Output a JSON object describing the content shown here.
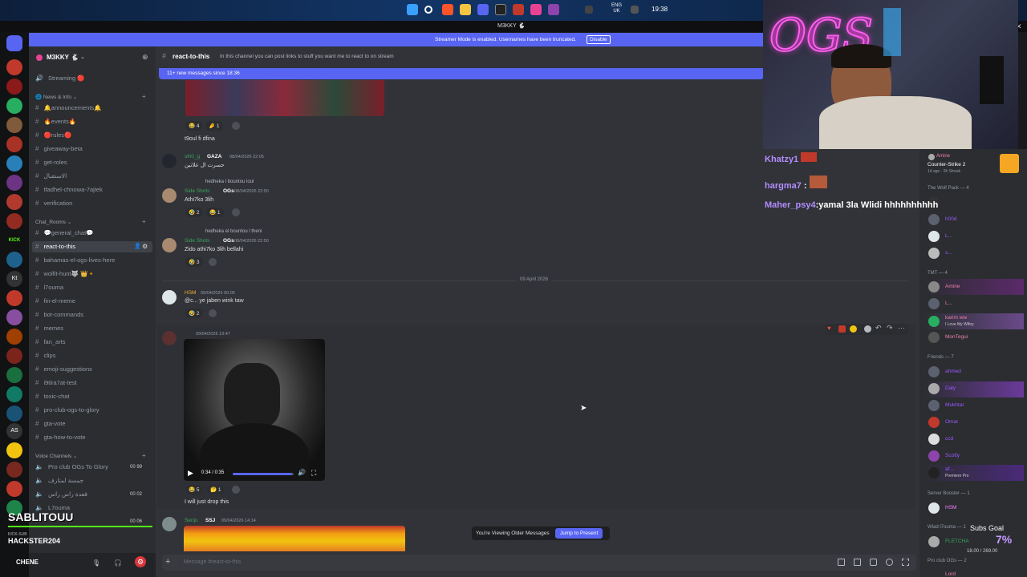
{
  "os": {
    "time": "19:38",
    "lang_top": "ENG",
    "lang_bottom": "UK"
  },
  "window": {
    "title": "M3KKY 🐇"
  },
  "banner": {
    "text": "Streamer Mode is enabled. Usernames have been truncated.",
    "button": "Disable"
  },
  "server": {
    "name": "M3KKY 🐇"
  },
  "sidebar": {
    "top_items": [
      {
        "label": "Streaming 🔴"
      }
    ],
    "category_news": "News & Info",
    "news": [
      "🔔announcements🔔",
      "🔥events🔥",
      "🔴rules🔴",
      "giveaway-beta",
      "get-roles",
      "الاستقبال",
      "tfadhel-chnowa-7ajtek",
      "verification"
    ],
    "category_chat": "Chat_Rooms",
    "chat": [
      "💬general_chat💬",
      "react-to-this",
      "bahamas-el-ogs-lives-here",
      "wolfit-hunt🐺 👑🔸",
      "l7ouma",
      "fin-el-meme",
      "bot-commands",
      "memes",
      "fan_arts",
      "clips",
      "emoji-suggestions",
      "i9tira7at-test",
      "toxic-chat",
      "pro-club-ogs-to-glory",
      "gta-vote",
      "gta-how-to-vote"
    ],
    "category_voice": "Voice Channels",
    "voice": [
      {
        "label": "Pro club OGs To Glory",
        "count": "00 99"
      },
      {
        "label": "جمسة لمتارف",
        "count": ""
      },
      {
        "label": "قعدة راس راس",
        "count": "00 02"
      },
      {
        "label": "L7ouma",
        "count": ""
      },
      {
        "label": "",
        "count": "00 06"
      }
    ],
    "user_name": "HACKSTER204",
    "user_sub": "KICK-SUB"
  },
  "header": {
    "channel": "react-to-this",
    "topic": "In this channel you can post links to stuff you want me to react to on stream"
  },
  "new_messages": "11+ new messages since 18:36",
  "messages": [
    {
      "reactions": [
        "😂 4",
        "🤌 1"
      ],
      "text": "t9oul fi dfina"
    },
    {
      "name": "slh0_g",
      "tag": "GAZA",
      "time": "08/04/2026 22:05",
      "text": "حسرت ال علاتين"
    },
    {
      "reply": "hedheka l bountou loul",
      "name": "Side Shots",
      "tag": "OGs",
      "time": "08/04/2026 22:50",
      "text": "Athi7ko 3lih",
      "reactions": [
        "🤣 2",
        "😂 1"
      ]
    },
    {
      "reply": "hedheka el bountou l theni",
      "name": "Side Shots",
      "tag": "OGs",
      "time": "08/04/2026 22:50",
      "text": "Zido athi7ko 3lih bellahi",
      "reactions": [
        "🤣 3"
      ]
    },
    {
      "name": "HSM",
      "time": "09/04/2026 00:05",
      "text": "@c... ye jaben wink taw",
      "reactions": [
        "🤣 2"
      ]
    },
    {
      "name": "",
      "time": "09/04/2026 13:47",
      "video_time": "0:34 / 0:35",
      "text": "I will just drop this",
      "reactions": [
        "😂 5",
        "🤔 1"
      ]
    },
    {
      "name": "Senju",
      "tag": "SSJ",
      "time": "09/04/2026 14:14"
    }
  ],
  "date_divider": "09 April 2026",
  "older": {
    "label": "You're Viewing Older Messages",
    "button": "Jump to Present"
  },
  "composer": {
    "placeholder": "Message #react-to-this"
  },
  "overlay": [
    {
      "name": "Khatzy1",
      "text": ""
    },
    {
      "name": "hargma7",
      "text": ""
    },
    {
      "name": "Maher_psy4",
      "text": ":yamal 3la Wlidi hhhhhhhhhh"
    }
  ],
  "members": {
    "activity_name": "Amine",
    "activity_game": "Counter-Strike 2",
    "activity_sub": "1d ago · 5h Streak",
    "group1": "The Wolf Pack — 4",
    "group1_items": [
      "h00d",
      "L...",
      "s..."
    ],
    "group2": "TMT — 4",
    "group2_items": [
      "Amine",
      "L...",
      "karim ww",
      "MonTegui"
    ],
    "karim_sub": "I Love My Wifey",
    "group3": "Friends — 7",
    "group3_items": [
      "ahmed",
      "Daly",
      "Mukhtar",
      "Omar",
      "ccd",
      "Scotty",
      "af..."
    ],
    "premiere": "Premiere Pro",
    "group4": "Server Booster — 1",
    "group4_items": [
      "HSM"
    ],
    "group5": "Wlad l7ouma — 1",
    "group5_items": [
      "FLETCHA"
    ],
    "group6": "Pro club OGs — 2",
    "group6_items": [
      "Lord"
    ],
    "subs_goal": "Subs Goal",
    "subs_pct": "7%",
    "subs_counts": "18.00 / 269.00"
  },
  "stream_name": "SABLITOUU",
  "stream_user": "CHENE",
  "colors": {
    "accent": "#5865f2",
    "green": "#23a55a",
    "overlay_name": "#b38cff"
  }
}
